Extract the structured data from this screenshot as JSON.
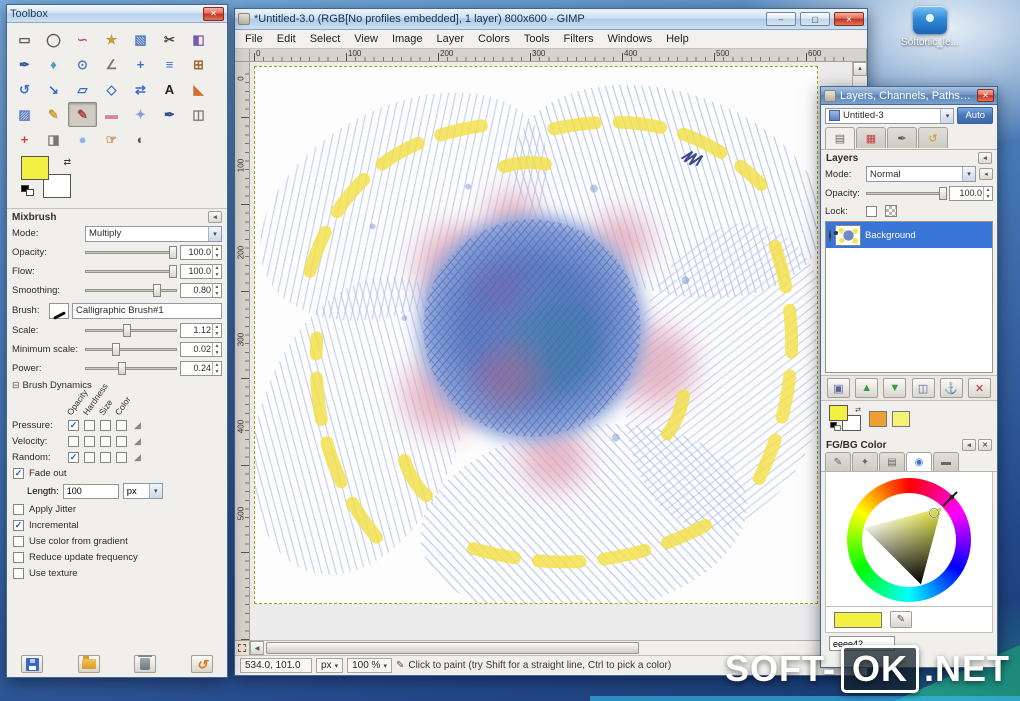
{
  "icons": {
    "close": "✕",
    "minimize": "–",
    "maximize": "▢",
    "dropdown": "▾",
    "spin_up": "▲",
    "spin_down": "▼",
    "menu_left": "◂",
    "ramp": "◢",
    "expander": "⊟",
    "check": "✓",
    "scroll_up": "▲",
    "scroll_down": "▼",
    "scroll_left": "◀",
    "scroll_right": "▶",
    "nav": "⊞",
    "swap": "⇄",
    "brush_hint": "✎"
  },
  "colors": {
    "fg": "#f4ef43",
    "bg": "#ffffff",
    "selection": "#3875d7"
  },
  "desktop": {
    "shortcut_label": "Softonic_le...",
    "watermark_pre": "SOFT-",
    "watermark_mid": "OK",
    "watermark_post": ".NET"
  },
  "toolbox": {
    "title": "Toolbox",
    "tools": [
      {
        "name": "rectangle-select",
        "glyph": "▭",
        "color": "#5a5a5a"
      },
      {
        "name": "ellipse-select",
        "glyph": "◯",
        "color": "#5a5a5a"
      },
      {
        "name": "free-select",
        "glyph": "∽",
        "color": "#b5568a"
      },
      {
        "name": "fuzzy-select",
        "glyph": "★",
        "color": "#c79a3a"
      },
      {
        "name": "select-by-color",
        "glyph": "▧",
        "color": "#4a7ac0"
      },
      {
        "name": "scissors-select",
        "glyph": "✂",
        "color": "#444444"
      },
      {
        "name": "foreground-select",
        "glyph": "◧",
        "color": "#7a5ab0"
      },
      {
        "name": "paths",
        "glyph": "✒",
        "color": "#3a5fa0"
      },
      {
        "name": "color-picker",
        "glyph": "♦",
        "color": "#40a0c8"
      },
      {
        "name": "zoom",
        "glyph": "⊙",
        "color": "#4a78c0"
      },
      {
        "name": "measure",
        "glyph": "∠",
        "color": "#777777"
      },
      {
        "name": "move",
        "glyph": "+",
        "color": "#3a6fd0"
      },
      {
        "name": "align",
        "glyph": "≡",
        "color": "#3a6fd0"
      },
      {
        "name": "crop",
        "glyph": "⊞",
        "color": "#9a6a3a"
      },
      {
        "name": "rotate",
        "glyph": "↺",
        "color": "#3a6fd0"
      },
      {
        "name": "scale",
        "glyph": "↘",
        "color": "#3a6fd0"
      },
      {
        "name": "shear",
        "glyph": "▱",
        "color": "#3a6fd0"
      },
      {
        "name": "perspective",
        "glyph": "◇",
        "color": "#3a6fd0"
      },
      {
        "name": "flip",
        "glyph": "⇄",
        "color": "#3a6fd0"
      },
      {
        "name": "text",
        "glyph": "A",
        "color": "#222222"
      },
      {
        "name": "bucket-fill",
        "glyph": "◣",
        "color": "#d07030"
      },
      {
        "name": "blend",
        "glyph": "▨",
        "color": "#5a7ac8"
      },
      {
        "name": "pencil",
        "glyph": "✎",
        "color": "#c8a030"
      },
      {
        "name": "paintbrush",
        "glyph": "✎",
        "color": "#b04040",
        "active": true
      },
      {
        "name": "eraser",
        "glyph": "▬",
        "color": "#d08aa0"
      },
      {
        "name": "airbrush",
        "glyph": "✦",
        "color": "#8aa0d8"
      },
      {
        "name": "ink",
        "glyph": "✒",
        "color": "#37508e"
      },
      {
        "name": "clone",
        "glyph": "◫",
        "color": "#777777"
      },
      {
        "name": "heal",
        "glyph": "+",
        "color": "#d04040"
      },
      {
        "name": "perspective-clone",
        "glyph": "◨",
        "color": "#777777"
      },
      {
        "name": "blur-sharpen",
        "glyph": "●",
        "color": "#8ab4e0"
      },
      {
        "name": "smudge",
        "glyph": "☞",
        "color": "#d08a50"
      },
      {
        "name": "dodge-burn",
        "glyph": "◐",
        "color": "#555555"
      }
    ],
    "options": {
      "title": "Mixbrush",
      "mode": {
        "label": "Mode:",
        "value": "Multiply"
      },
      "sliders": [
        {
          "name": "opacity",
          "label": "Opacity:",
          "value": "100.0",
          "pct": 96
        },
        {
          "name": "flow",
          "label": "Flow:",
          "value": "100.0",
          "pct": 96
        },
        {
          "name": "smoothing",
          "label": "Smoothing:",
          "value": "0.80",
          "pct": 78
        }
      ],
      "brush": {
        "label": "Brush:",
        "value": "Calligraphic Brush#1"
      },
      "sliders2": [
        {
          "name": "scale",
          "label": "Scale:",
          "value": "1.12",
          "pct": 46
        },
        {
          "name": "minimum-scale",
          "label": "Minimum scale:",
          "value": "0.02",
          "pct": 34
        },
        {
          "name": "power",
          "label": "Power:",
          "value": "0.24",
          "pct": 40
        }
      ],
      "dynamics": {
        "title": "Brush Dynamics",
        "columns": [
          "Opacity",
          "Hardness",
          "Size",
          "Color"
        ],
        "rows": [
          {
            "name": "pressure",
            "label": "Pressure:",
            "checks": [
              true,
              false,
              false,
              false
            ]
          },
          {
            "name": "velocity",
            "label": "Velocity:",
            "checks": [
              false,
              false,
              false,
              false
            ]
          },
          {
            "name": "random",
            "label": "Random:",
            "checks": [
              true,
              false,
              false,
              false
            ]
          }
        ]
      },
      "fade_out": {
        "label": "Fade out",
        "checked": true
      },
      "length": {
        "label": "Length:",
        "value": "100",
        "unit": "px"
      },
      "checks": [
        {
          "name": "apply-jitter",
          "label": "Apply Jitter",
          "checked": false
        },
        {
          "name": "incremental",
          "label": "Incremental",
          "checked": true
        },
        {
          "name": "use-color-from-gradient",
          "label": "Use color from gradient",
          "checked": false
        },
        {
          "name": "reduce-update-frequency",
          "label": "Reduce update frequency",
          "checked": false
        },
        {
          "name": "use-texture",
          "label": "Use texture",
          "checked": false
        }
      ]
    }
  },
  "window": {
    "title": "*Untitled-3.0 (RGB[No profiles embedded], 1 layer) 800x600 - GIMP",
    "menus": [
      "File",
      "Edit",
      "Select",
      "View",
      "Image",
      "Layer",
      "Colors",
      "Tools",
      "Filters",
      "Windows",
      "Help"
    ],
    "hruler": [
      "0",
      "100",
      "200",
      "300",
      "400",
      "500",
      "600"
    ],
    "vruler": [
      "0",
      "100",
      "200",
      "300",
      "400",
      "500"
    ],
    "status": {
      "position": "534.0, 101.0",
      "unit": "px",
      "zoom": "100 %",
      "hint": "Click to paint (try Shift for a straight line, Ctrl to pick a color)"
    }
  },
  "layers_dialog": {
    "title": "Layers, Channels, Paths, Undo - FG...",
    "image_name": "Untitled-3",
    "auto_label": "Auto",
    "section_label": "Layers",
    "tabs": [
      {
        "name": "layers",
        "glyph": "▤",
        "color": "#666666",
        "active": true
      },
      {
        "name": "channels",
        "glyph": "▦",
        "color": "#c03a3a",
        "active": false
      },
      {
        "name": "paths",
        "glyph": "✒",
        "color": "#555555",
        "active": false
      },
      {
        "name": "undo",
        "glyph": "↺",
        "color": "#c89a20",
        "active": false
      }
    ],
    "mode": {
      "label": "Mode:",
      "value": "Normal"
    },
    "opacity": {
      "label": "Opacity:",
      "value": "100.0",
      "pct": 97
    },
    "lock_label": "Lock:",
    "layers": [
      {
        "name": "Background",
        "visible": true,
        "selected": true
      }
    ],
    "footer_buttons": [
      {
        "name": "new-layer",
        "glyph": "▣",
        "color": "#556699"
      },
      {
        "name": "raise-layer",
        "glyph": "▲",
        "color": "#3a9a3a"
      },
      {
        "name": "lower-layer",
        "glyph": "▼",
        "color": "#3a9a3a"
      },
      {
        "name": "duplicate-layer",
        "glyph": "◫",
        "color": "#556699"
      },
      {
        "name": "anchor-layer",
        "glyph": "⚓",
        "color": "#445566"
      },
      {
        "name": "delete-layer",
        "glyph": "✕",
        "color": "#aa3333"
      }
    ],
    "mini_swatches": [
      "#f0a030",
      "#f6f276"
    ],
    "color_tabs": [
      {
        "name": "paint-options",
        "glyph": "✎",
        "color": "#666666",
        "active": false
      },
      {
        "name": "brushes",
        "glyph": "✦",
        "color": "#666666",
        "active": false
      },
      {
        "name": "palettes",
        "glyph": "▤",
        "color": "#666666",
        "active": false
      },
      {
        "name": "colors",
        "glyph": "◉",
        "color": "#3a6fd0",
        "active": true
      },
      {
        "name": "gradients",
        "glyph": "▬",
        "color": "#666666",
        "active": false
      }
    ],
    "fgbg": {
      "label": "FG/BG Color",
      "hex": "eeee42"
    }
  }
}
